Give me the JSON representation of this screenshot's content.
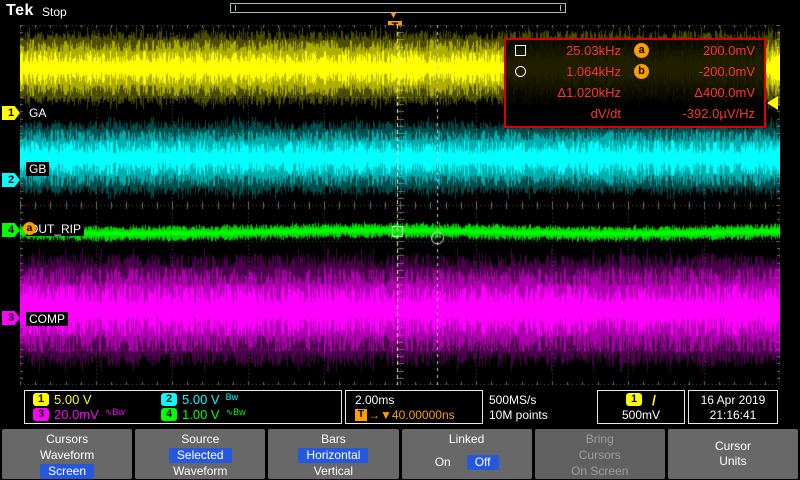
{
  "header": {
    "logo": "Tek",
    "status": "Stop"
  },
  "trigger": {
    "symbol": "T",
    "caret": "▼"
  },
  "channels": [
    {
      "num": "1",
      "name": "GA",
      "color": "#ffff00",
      "scale": "5.00 V",
      "flags": ""
    },
    {
      "num": "2",
      "name": "GB",
      "color": "#00ffff",
      "scale": "5.00 V",
      "flags": "Bw"
    },
    {
      "num": "3",
      "name": "COMP",
      "color": "#ff00ff",
      "scale": "20.0mV",
      "flags": "∿Bw"
    },
    {
      "num": "4",
      "name": "OUT_RIP",
      "color": "#00ff00",
      "scale": "1.00 V",
      "flags": "∿Bw"
    }
  ],
  "cursor_readout": {
    "a_label": "a",
    "b_label": "b",
    "a_freq": "25.03kHz",
    "a_value": "200.0mV",
    "b_freq": "1.064kHz",
    "b_value": "-200.0mV",
    "delta_freq": "Δ1.020kHz",
    "delta_value": "Δ400.0mV",
    "dvdt_label": "dV/dt",
    "dvdt_value": "-392.0µV/Hz"
  },
  "status": {
    "timebase": "2.00ms",
    "trigger_pos_arrows": "→▼",
    "trigger_pos": "40.00000ns",
    "sample_rate": "500MS/s",
    "record_length": "10M points",
    "trigger_source": "1",
    "trigger_slope": "/",
    "trigger_level": "500mV",
    "date": "16 Apr 2019",
    "time": "21:16:41"
  },
  "menu": [
    {
      "t": "Cursors",
      "l1": "Waveform",
      "l2": "Screen"
    },
    {
      "t": "Source",
      "l1": "Selected",
      "l2": "Waveform"
    },
    {
      "t": "Bars",
      "l1": "Horizontal",
      "l2": "Vertical"
    },
    {
      "t": "Linked",
      "l1": "On",
      "l2": "Off"
    },
    {
      "t": "Bring",
      "l1": "Cursors",
      "l2": "On Screen"
    },
    {
      "t": "Cursor",
      "l1": "Units"
    }
  ]
}
